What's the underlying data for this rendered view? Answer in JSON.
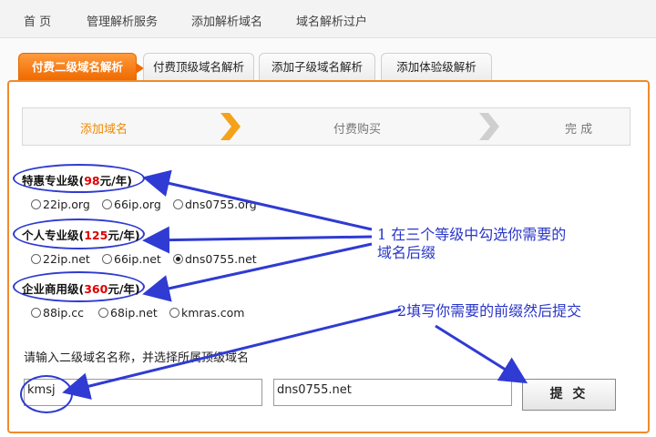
{
  "topnav": [
    "首 页",
    "管理解析服务",
    "添加解析域名",
    "域名解析过户"
  ],
  "tabs": [
    "付费二级域名解析",
    "付费顶级域名解析",
    "添加子级域名解析",
    "添加体验级解析"
  ],
  "steps": [
    "添加域名",
    "付费购买",
    "完 成"
  ],
  "levels": [
    {
      "label": "特惠专业级(",
      "price": "98",
      "unit": "元/年)",
      "options": [
        "22ip.org",
        "66ip.org",
        "dns0755.org"
      ],
      "selected": -1
    },
    {
      "label": "个人专业级(",
      "price": "125",
      "unit": "元/年)",
      "options": [
        "22ip.net",
        "66ip.net",
        "dns0755.net"
      ],
      "selected": 2
    },
    {
      "label": "企业商用级(",
      "price": "360",
      "unit": "元/年)",
      "options": [
        "88ip.cc",
        "68ip.net",
        "kmras.com"
      ],
      "selected": -1
    }
  ],
  "form": {
    "prompt": "请输入二级域名名称，并选择所属顶级域名",
    "name_value": "kmsj",
    "domain_value": "dns0755.net",
    "submit_label": "提 交"
  },
  "notes": {
    "note1_line1": "1 在三个等级中勾选你需要的",
    "note1_line2": "域名后缀",
    "note2": "2填写你需要的前缀然后提交"
  },
  "colors": {
    "accent": "#ef6a00",
    "annotation": "#2f3bd2",
    "price": "#dd0000",
    "step_active": "#f08a00"
  }
}
